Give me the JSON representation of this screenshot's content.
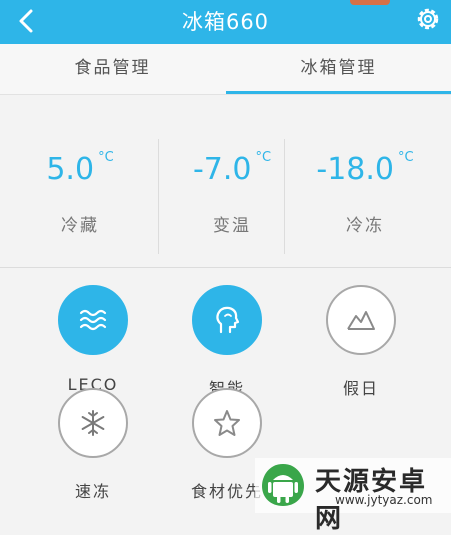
{
  "header": {
    "title": "冰箱660",
    "back_icon": "chevron-left-icon",
    "settings_icon": "gear-icon",
    "color": "#2eb5e8"
  },
  "tabs": [
    {
      "label": "食品管理",
      "active": false
    },
    {
      "label": "冰箱管理",
      "active": true
    }
  ],
  "temperatures": [
    {
      "value": "5.0",
      "unit": "°C",
      "name": "冷藏"
    },
    {
      "value": "-7.0",
      "unit": "°C",
      "name": "变温"
    },
    {
      "value": "-18.0",
      "unit": "°C",
      "name": "冷冻"
    }
  ],
  "modes": [
    {
      "label": "LECO",
      "icon": "waves-icon",
      "active": true
    },
    {
      "label": "智能",
      "icon": "head-icon",
      "active": true
    },
    {
      "label": "假日",
      "icon": "mountain-icon",
      "active": false
    },
    {
      "label": "速冻",
      "icon": "snowflake-icon",
      "active": false
    },
    {
      "label": "食材优先",
      "icon": "star-icon",
      "active": false
    }
  ],
  "watermark": {
    "title": "天源安卓网",
    "url": "www.jytyaz.com"
  }
}
